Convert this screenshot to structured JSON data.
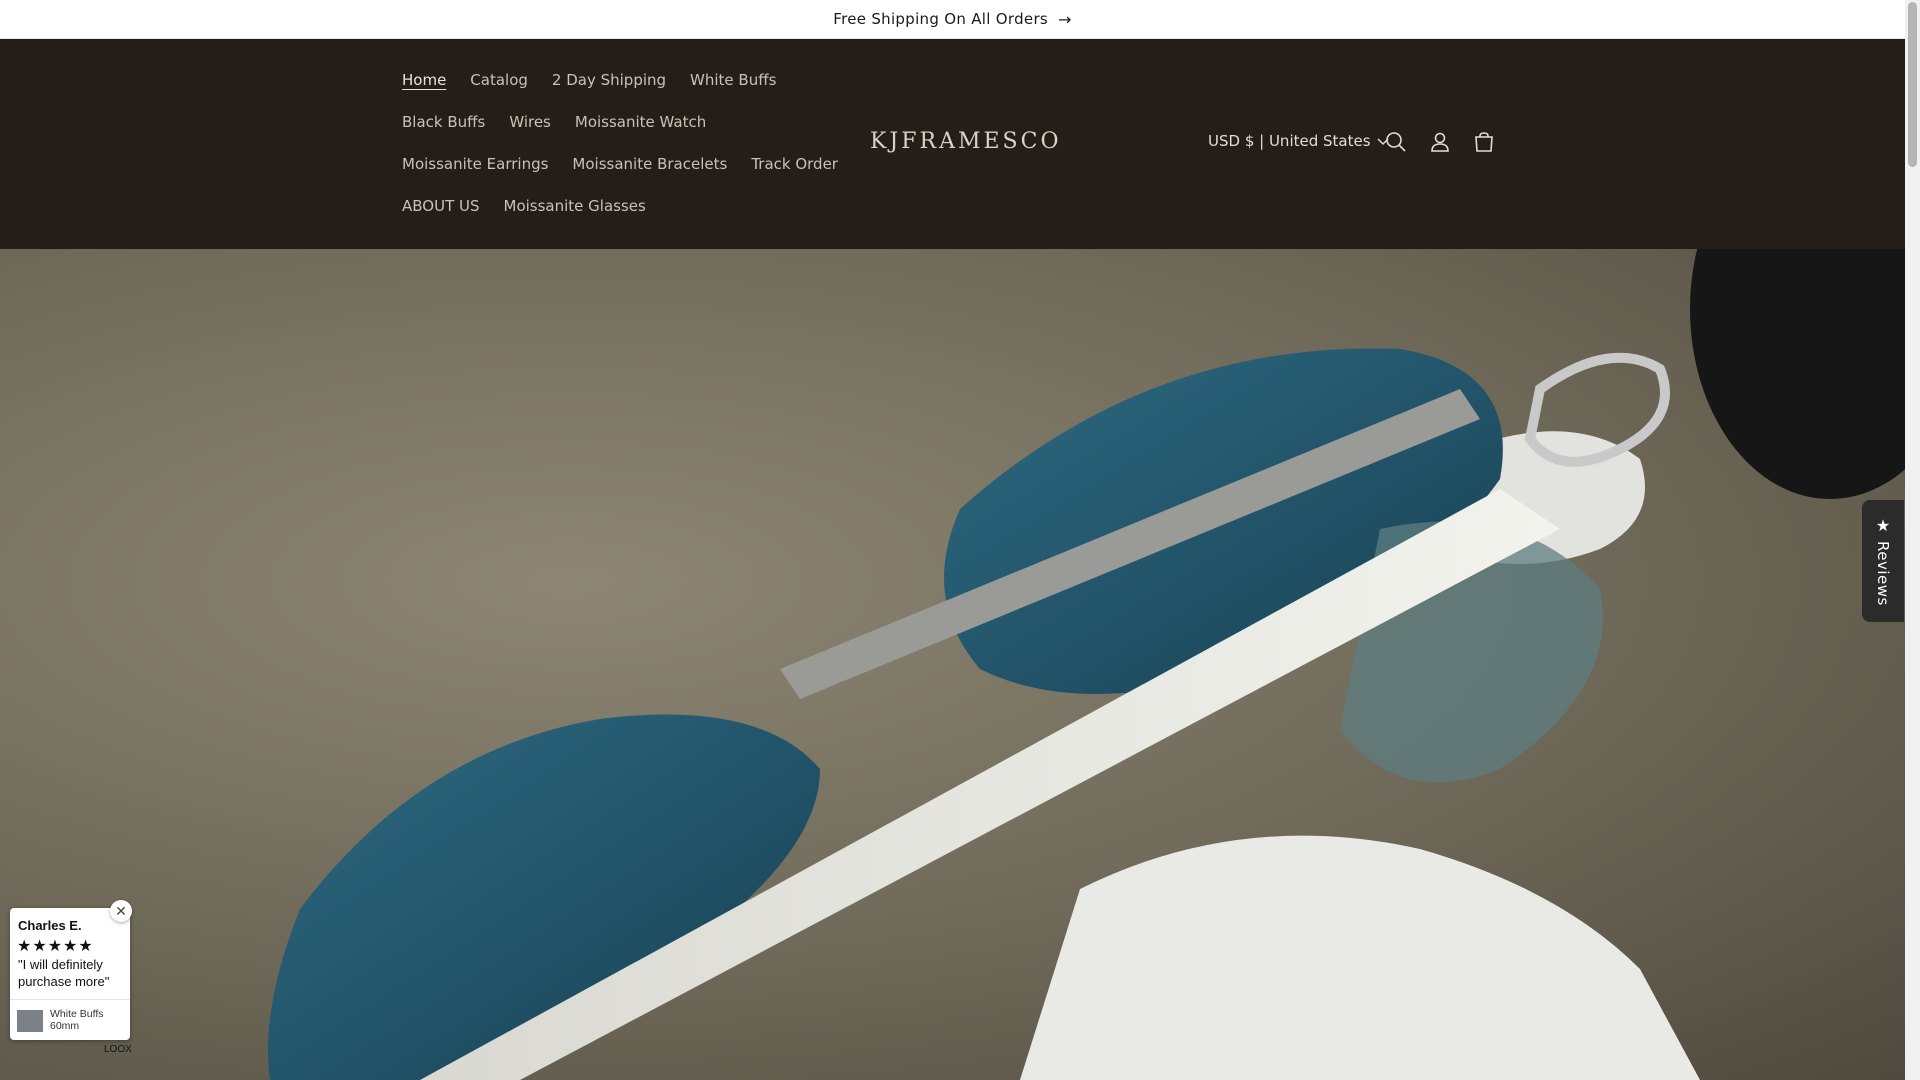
{
  "announcement": {
    "text": "Free Shipping On All Orders",
    "arrow": "arrow-right-icon"
  },
  "header": {
    "nav_rows": [
      [
        "Home",
        "Catalog",
        "2 Day Shipping",
        "White Buffs"
      ],
      [
        "Black Buffs",
        "Wires",
        "Moissanite Watch"
      ],
      [
        "Moissanite Earrings",
        "Moissanite Bracelets",
        "Track Order"
      ],
      [
        "ABOUT US",
        "Moissanite Glasses"
      ]
    ],
    "active": "Home",
    "logo": "KJFRAMESCO",
    "currency": "USD $ | United States",
    "icons": [
      "search-icon",
      "account-icon",
      "cart-icon"
    ]
  },
  "reviews_tab": {
    "label": "Reviews",
    "icon": "star-icon"
  },
  "review_popup": {
    "name": "Charles E.",
    "stars": "★★★★★",
    "quote": "\"I will definitely purchase more\"",
    "product_line1": "White Buffs",
    "product_line2": "60mm",
    "brand": "LOOX"
  },
  "colors": {
    "header_bg": "#231f18",
    "nav_text": "#c8c2b6",
    "lens": "#235a70"
  }
}
